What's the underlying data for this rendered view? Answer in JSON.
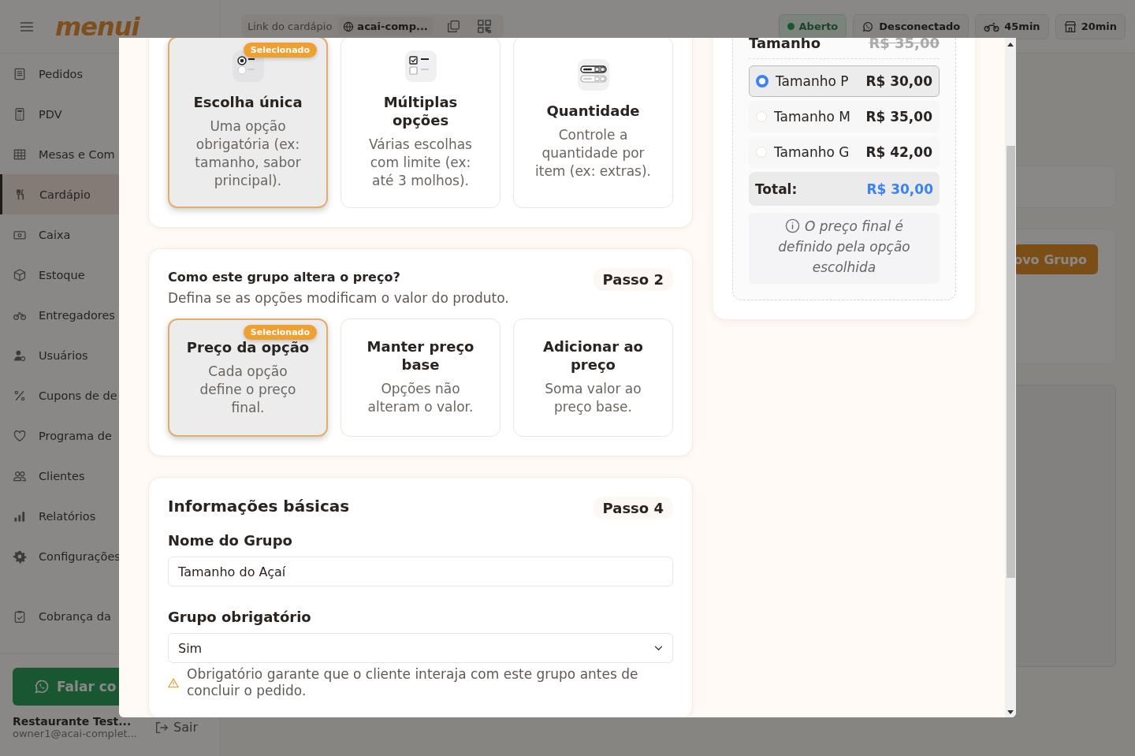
{
  "sidebar": {
    "logo": "menui",
    "items": [
      {
        "label": "Pedidos",
        "selected": false
      },
      {
        "label": "PDV",
        "selected": false
      },
      {
        "label": "Mesas e Com",
        "selected": false
      },
      {
        "label": "Cardápio",
        "selected": true
      },
      {
        "label": "Caixa",
        "selected": false
      },
      {
        "label": "Estoque",
        "selected": false
      },
      {
        "label": "Entregadores",
        "selected": false
      },
      {
        "label": "Usuários",
        "selected": false
      },
      {
        "label": "Cupons de de",
        "selected": false
      },
      {
        "label": "Programa de",
        "selected": false
      },
      {
        "label": "Clientes",
        "selected": false
      },
      {
        "label": "Relatórios",
        "selected": false
      },
      {
        "label": "Configurações",
        "selected": false
      },
      {
        "label": "Cobrança da",
        "selected": false
      }
    ],
    "support_button": "Falar co",
    "restaurant": "Restaurante Test...",
    "email": "owner1@acai-complet...",
    "logout": "Sair"
  },
  "topbar": {
    "link_label": "Link do cardápio",
    "link_value": "acai-comp...",
    "status": [
      {
        "label": "Aberto",
        "kind": "open"
      },
      {
        "label": "Desconectado",
        "kind": "whatsapp"
      },
      {
        "label": "45min",
        "kind": "delivery"
      },
      {
        "label": "20min",
        "kind": "pickup"
      }
    ]
  },
  "background": {
    "new_group_button": "ovo Grupo"
  },
  "modal": {
    "type_options": [
      {
        "title": "Escolha única",
        "description": "Uma opção obrigatória (ex: tamanho, sabor principal).",
        "selected": true,
        "badge": "Selecionado"
      },
      {
        "title": "Múltiplas opções",
        "description": "Várias escolhas com limite (ex: até 3 molhos).",
        "selected": false
      },
      {
        "title": "Quantidade",
        "description": "Controle a quantidade por item (ex: extras).",
        "selected": false
      }
    ],
    "price_section": {
      "title": "Como este grupo altera o preço?",
      "subtitle": "Defina se as opções modificam o valor do produto.",
      "step": "Passo 2",
      "options": [
        {
          "title": "Preço da opção",
          "description": "Cada opção define o preço final.",
          "selected": true,
          "badge": "Selecionado"
        },
        {
          "title": "Manter preço base",
          "description": "Opções não alteram o valor.",
          "selected": false
        },
        {
          "title": "Adicionar ao preço",
          "description": "Soma valor ao preço base.",
          "selected": false
        }
      ]
    },
    "basic_info": {
      "title": "Informações básicas",
      "step": "Passo 4",
      "name_label": "Nome do Grupo",
      "name_value": "Tamanho do Açaí",
      "required_label": "Grupo obrigatório",
      "required_value": "Sim",
      "required_hint": "Obrigatório garante que o cliente interaja com este grupo antes de concluir o pedido."
    },
    "preview": {
      "group_name": "Tamanho",
      "base_price": "R$ 35,00",
      "options": [
        {
          "name": "Tamanho P",
          "price": "R$ 30,00",
          "selected": true
        },
        {
          "name": "Tamanho M",
          "price": "R$ 35,00",
          "selected": false
        },
        {
          "name": "Tamanho G",
          "price": "R$ 42,00",
          "selected": false
        }
      ],
      "total_label": "Total:",
      "total_value": "R$ 30,00",
      "note": "O preço final é definido pela opção escolhida"
    }
  }
}
